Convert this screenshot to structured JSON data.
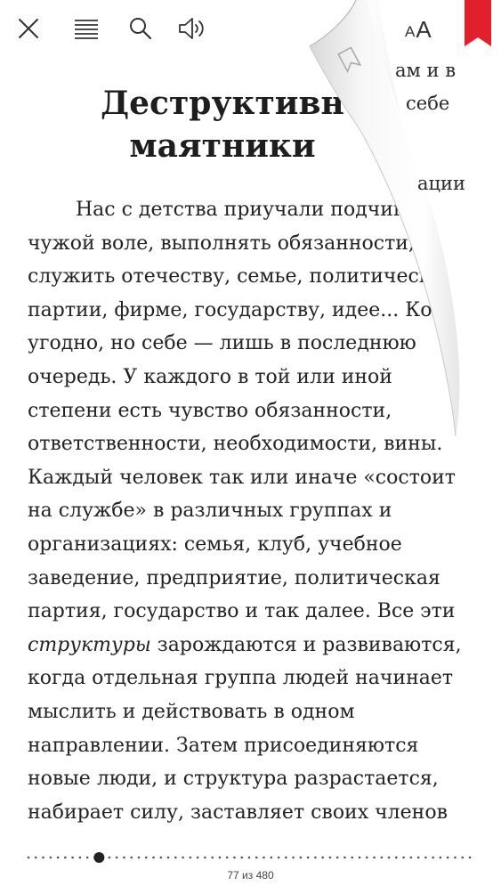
{
  "toolbar": {
    "close_icon": "close-icon",
    "toc_icon": "list-icon",
    "search_icon": "search-icon",
    "audio_icon": "speaker-icon",
    "font_label_small": "A",
    "font_label_big": "A",
    "bookmark_color": "#e0202a"
  },
  "chapter": {
    "title_line1": "Деструктивн",
    "title_line2": "маятники"
  },
  "next_page_peek": {
    "line1": "ам и в",
    "line2": "себе",
    "line3": "ации"
  },
  "body": {
    "lines": [
      "Нас с детства приучали подчин",
      "чужой воле, выполнять обязанности,",
      "служить отечеству, семье, политическо",
      "партии, фирме, государству, идее... Кому",
      "угодно, но себе — лишь в последнюю",
      "очередь. У каждого в той или иной",
      "степени есть чувство обязанности,",
      "ответственности, необходимости, вины.",
      "Каждый человек так или иначе «состоит",
      "на службе» в различных группах и",
      "организациях: семья, клуб, учебное",
      "заведение, предприятие, политическая",
      "партия, государство и так далее. Все эти"
    ],
    "line14_italic": "структуры",
    "line14_rest": " зарождаются и развиваются,",
    "lines_after": [
      "когда отдельная группа людей начинает",
      "мыслить и действовать в одном",
      "направлении. Затем присоединяются",
      "новые люди, и структура разрастается,",
      "набирает силу, заставляет своих членов"
    ]
  },
  "footer": {
    "page_indicator": "77 из 480",
    "progress_fraction": 0.16
  }
}
